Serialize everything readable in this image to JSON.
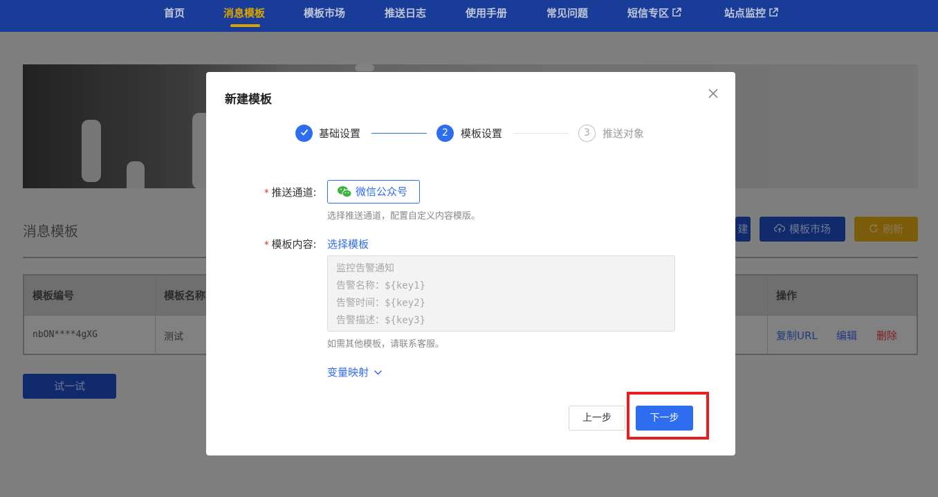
{
  "nav": {
    "items": [
      "首页",
      "消息模板",
      "模板市场",
      "推送日志",
      "使用手册",
      "常见问题",
      "短信专区",
      "站点监控"
    ],
    "active_index": 1
  },
  "background": {
    "section_title": "消息模板",
    "buttons": {
      "create": "建",
      "market": "模板市场",
      "refresh": "刷新"
    },
    "table": {
      "headers": [
        "模板编号",
        "模板名称",
        "操作"
      ],
      "row": {
        "id": "nbON****4gXG",
        "name": "测试",
        "actions": [
          "复制URL",
          "编辑",
          "删除"
        ]
      }
    },
    "try_button": "试一试"
  },
  "modal": {
    "title": "新建模板",
    "steps": [
      {
        "label": "基础设置",
        "number": "",
        "state": "done"
      },
      {
        "label": "模板设置",
        "number": "2",
        "state": "current"
      },
      {
        "label": "推送对象",
        "number": "3",
        "state": "todo"
      }
    ],
    "channel": {
      "label": "推送通道",
      "colon": ":",
      "value": "微信公众号",
      "hint": "选择推送通道，配置自定义内容模版。"
    },
    "content": {
      "label": "模板内容",
      "colon": ":",
      "select_link": "选择模板",
      "lines": [
        "监控告警通知",
        "告警名称：${key1}",
        "告警时间：${key2}",
        "告警描述：${key3}"
      ],
      "hint": "如需其他模板，请联系客服。"
    },
    "variable_mapping": "变量映射",
    "prev_button": "上一步",
    "next_button": "下一步"
  },
  "colors": {
    "nav_bg": "#1a3c99",
    "nav_active": "#d9a400",
    "primary": "#2f6df0",
    "highlight": "#e81e1e"
  }
}
